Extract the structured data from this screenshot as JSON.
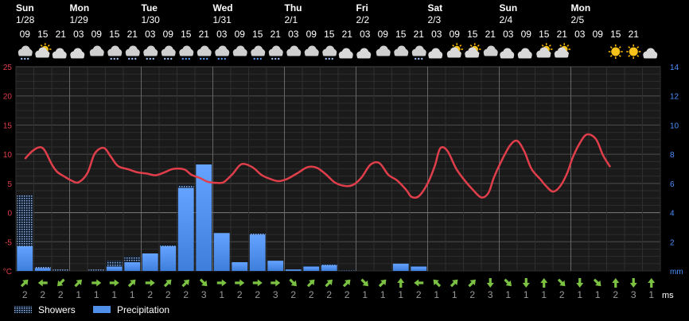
{
  "chart_data": {
    "type": "line",
    "days": [
      {
        "name": "Sun",
        "date": "1/28",
        "slot": 0
      },
      {
        "name": "Mon",
        "date": "1/29",
        "slot": 3
      },
      {
        "name": "Tue",
        "date": "1/30",
        "slot": 7
      },
      {
        "name": "Wed",
        "date": "1/31",
        "slot": 11
      },
      {
        "name": "Thu",
        "date": "2/1",
        "slot": 15
      },
      {
        "name": "Fri",
        "date": "2/2",
        "slot": 19
      },
      {
        "name": "Sat",
        "date": "2/3",
        "slot": 23
      },
      {
        "name": "Sun",
        "date": "2/4",
        "slot": 27
      },
      {
        "name": "Mon",
        "date": "2/5",
        "slot": 31
      }
    ],
    "hours": [
      "09",
      "15",
      "21",
      "03",
      "09",
      "15",
      "21",
      "03",
      "09",
      "15",
      "21",
      "03",
      "09",
      "15",
      "21",
      "03",
      "09",
      "15",
      "21",
      "03",
      "09",
      "15",
      "21",
      "03",
      "09",
      "15",
      "21",
      "03",
      "09",
      "15",
      "21",
      "03",
      "09",
      "15",
      "21"
    ],
    "weather_icons": [
      "cloud-snow-icon",
      "sun-cloud-icon",
      "moon-cloud-icon",
      "moon-cloud-icon",
      "cloud-icon",
      "cloud-snow-icon",
      "cloud-snow-icon",
      "cloud-snow-icon",
      "cloud-snow-icon",
      "cloud-rain-icon",
      "cloud-rain-icon",
      "cloud-rain-icon",
      "cloud-icon",
      "cloud-rain-icon",
      "cloud-snow-icon",
      "cloud-icon",
      "cloud-icon",
      "cloud-snow-icon",
      "moon-cloud-icon",
      "moon-cloud-icon",
      "cloud-icon",
      "cloud-icon",
      "cloud-snow-icon",
      "moon-cloud-icon",
      "sun-cloud-icon",
      "sun-cloud-icon",
      "cloud-icon",
      "moon-cloud-icon",
      "moon-cloud-icon",
      "sun-cloud-icon",
      "sun-cloud-icon",
      "moon-icon",
      "moon-icon",
      "sun-icon",
      "sun-icon",
      "moon-cloud-icon"
    ],
    "temperature": {
      "unit": "°C",
      "left_ticks": [
        25,
        20,
        15,
        10,
        5,
        0,
        -5
      ],
      "ylim": [
        -10,
        25
      ],
      "x": [
        0,
        0.4,
        0.8,
        1.1,
        1.5,
        1.8,
        2.2,
        2.6,
        3.0,
        3.5,
        3.9,
        4.4,
        4.8,
        5.2,
        5.8,
        6.3,
        6.8,
        7.3,
        7.8,
        8.3,
        8.9,
        9.3,
        9.8,
        10.2,
        10.7,
        11.1,
        11.6,
        12.1,
        12.7,
        13.2,
        13.6,
        14.1,
        14.5,
        14.8,
        15.3,
        15.8,
        16.3,
        16.8,
        17.3,
        17.8,
        18.3,
        18.8,
        19.3,
        19.8,
        20.3,
        20.8,
        21.3,
        21.6,
        22.0,
        22.5,
        22.9,
        23.2,
        23.6,
        24.1,
        24.6,
        25.0,
        25.5,
        25.9,
        26.2,
        26.6,
        27.1,
        27.5,
        27.9,
        28.3,
        28.8,
        29.1,
        29.5,
        29.9,
        30.3,
        30.6,
        31.0,
        31.4,
        31.9,
        32.3,
        32.7,
        33.1,
        33.5,
        33.9,
        34.1,
        34.5
      ],
      "values": [
        9.2,
        10.5,
        11.2,
        10.7,
        8.3,
        7.0,
        6.2,
        5.5,
        5.2,
        6.8,
        10.1,
        11.1,
        9.6,
        8.0,
        7.4,
        6.9,
        6.7,
        6.4,
        6.9,
        7.5,
        7.4,
        6.5,
        5.9,
        5.3,
        5.1,
        5.2,
        6.6,
        8.3,
        7.8,
        6.5,
        5.9,
        5.4,
        5.6,
        6.0,
        6.9,
        7.8,
        7.7,
        6.6,
        5.2,
        4.6,
        4.7,
        6.0,
        8.2,
        8.5,
        6.5,
        5.5,
        3.9,
        2.7,
        2.8,
        5.0,
        8.0,
        11.0,
        10.6,
        7.5,
        5.4,
        4.0,
        2.6,
        3.4,
        6.0,
        8.7,
        11.5,
        12.3,
        10.5,
        7.5,
        5.7,
        4.6,
        3.6,
        4.5,
        6.8,
        9.4,
        11.9,
        13.4,
        12.6,
        9.8,
        7.8,
        5.6
      ],
      "line_color": "#e03e4a"
    },
    "precipitation": {
      "unit": "mm",
      "right_ticks": [
        14,
        12,
        10,
        8,
        6,
        4,
        2
      ],
      "ylim": [
        0,
        14
      ],
      "x_slots": [
        0,
        1,
        2,
        3,
        4,
        5,
        6,
        7,
        8,
        9,
        10,
        11,
        12,
        13,
        14,
        15,
        16,
        17,
        18,
        19,
        20,
        21,
        22,
        23,
        24,
        25,
        26,
        27,
        28,
        29,
        30,
        31,
        32,
        33,
        34,
        35
      ],
      "precipitation": [
        1.7,
        0.2,
        0,
        0,
        0,
        0.3,
        0.6,
        1.2,
        1.7,
        5.7,
        7.3,
        2.6,
        0.6,
        2.5,
        0.7,
        0.1,
        0.3,
        0.4,
        0,
        0,
        0,
        0.5,
        0.3,
        0,
        0,
        0,
        0,
        0,
        0,
        0,
        0,
        0,
        0,
        0,
        0,
        0
      ],
      "showers": [
        3.5,
        0.1,
        0.1,
        0,
        0.1,
        0.4,
        0.4,
        0,
        0.1,
        0.2,
        0,
        0,
        0,
        0.1,
        0,
        0,
        0.05,
        0.1,
        0.05,
        0,
        0,
        0,
        0.05,
        0,
        0,
        0,
        0,
        0,
        0,
        0,
        0,
        0,
        0,
        0,
        0,
        0
      ],
      "precip_color": "#4f8fe8",
      "showers_color": "#6a8ec4"
    },
    "wind": {
      "unit": "ms",
      "directions": [
        45,
        270,
        225,
        45,
        90,
        90,
        45,
        90,
        45,
        45,
        135,
        90,
        90,
        90,
        90,
        135,
        45,
        45,
        45,
        135,
        45,
        0,
        270,
        315,
        45,
        45,
        180,
        135,
        180,
        0,
        135,
        180,
        135,
        0,
        180,
        0
      ],
      "speeds": [
        2,
        2,
        2,
        1,
        1,
        1,
        1,
        2,
        2,
        2,
        3,
        1,
        2,
        2,
        3,
        2,
        2,
        2,
        2,
        1,
        1,
        1,
        2,
        1,
        1,
        2,
        3,
        1,
        1,
        1,
        2,
        1,
        1,
        2,
        3,
        1
      ],
      "arrow_color": "#7cc242",
      "speed_color": "#9a9a9a"
    },
    "legend": [
      {
        "label": "Showers",
        "kind": "showers"
      },
      {
        "label": "Precipitation",
        "kind": "precipitation"
      }
    ],
    "grid": true
  }
}
